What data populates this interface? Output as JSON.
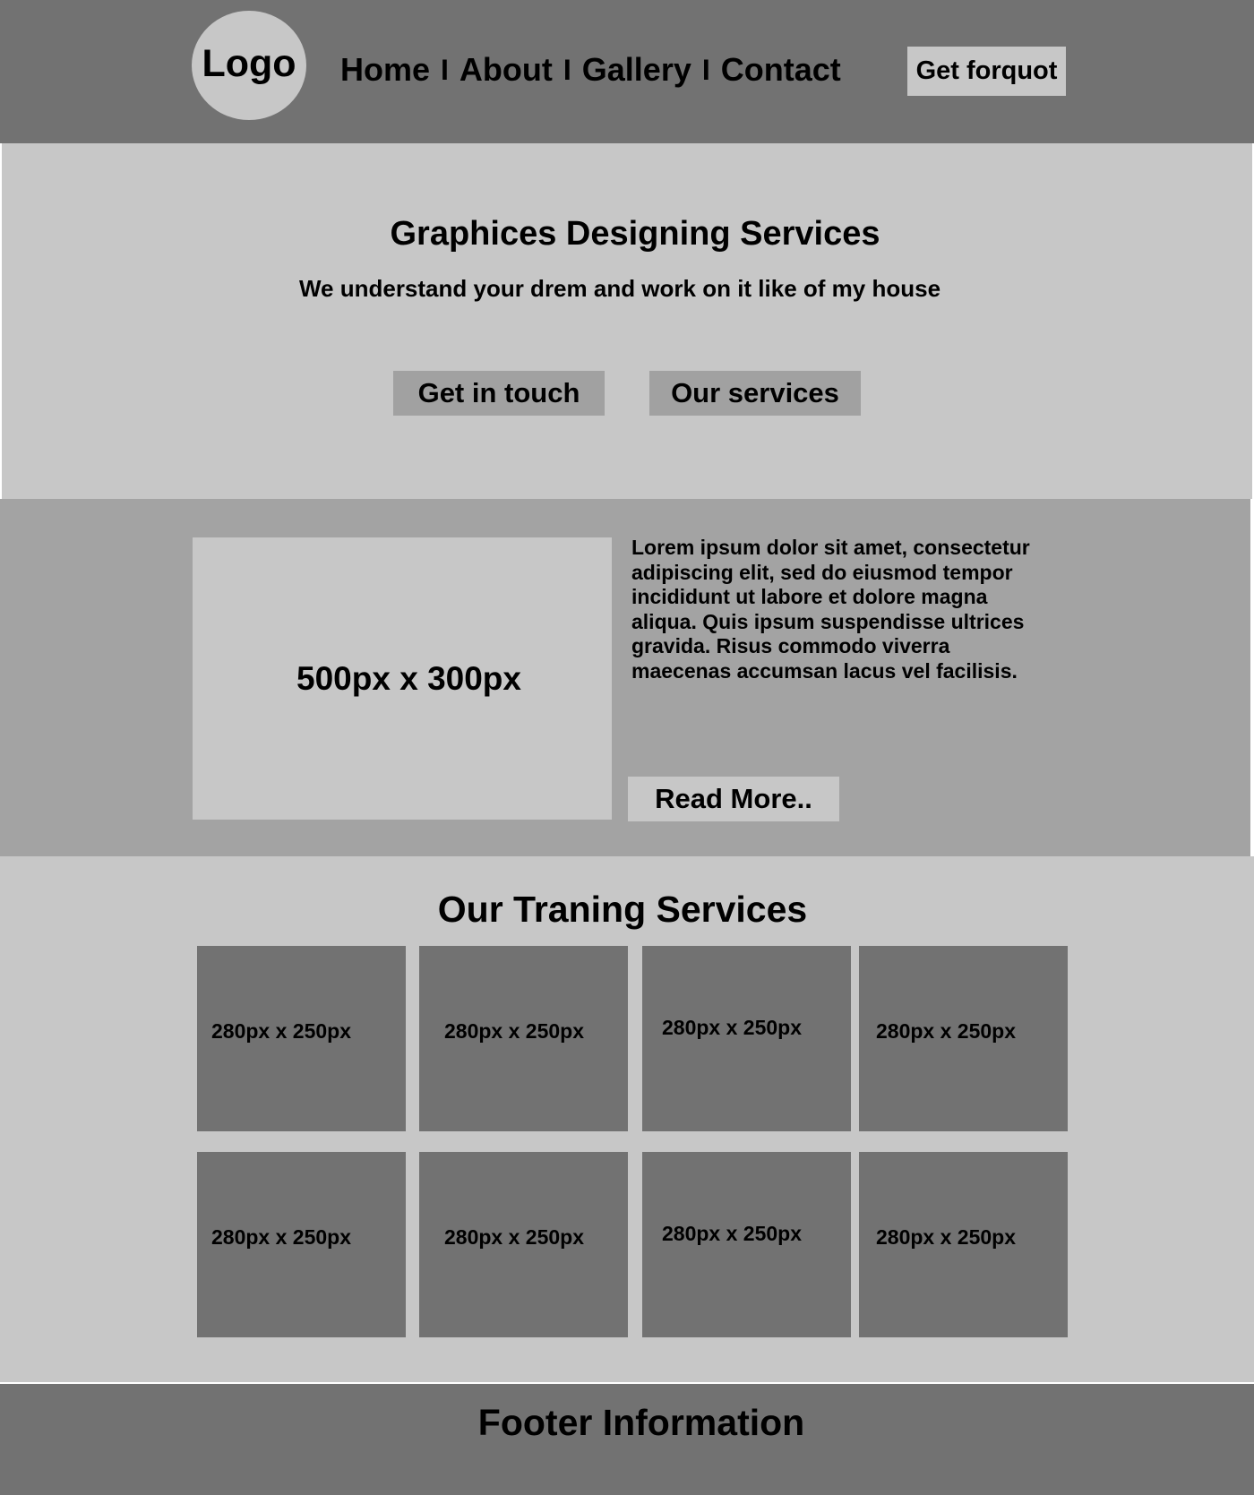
{
  "header": {
    "logo": "Logo",
    "nav": [
      {
        "label": "Home"
      },
      {
        "label": "About"
      },
      {
        "label": "Gallery"
      },
      {
        "label": "Contact"
      }
    ],
    "nav_separator": "I",
    "quote_button": "Get forquot"
  },
  "hero": {
    "title": "Graphices Designing Services",
    "subtitle": "We understand your drem and work on it like of my house",
    "buttons": [
      {
        "label": "Get in touch"
      },
      {
        "label": "Our services"
      }
    ]
  },
  "about": {
    "image_placeholder": "500px x 300px",
    "text": "Lorem ipsum dolor sit amet, consectetur adipiscing elit, sed do eiusmod tempor incididunt ut labore et dolore magna aliqua. Quis ipsum suspendisse ultrices gravida. Risus commodo viverra maecenas accumsan lacus vel facilisis.",
    "read_more": "Read More.."
  },
  "training": {
    "title": "Our Traning Services",
    "cards": [
      {
        "label": "280px x 250px"
      },
      {
        "label": "280px x 250px"
      },
      {
        "label": "280px x 250px"
      },
      {
        "label": "280px x 250px"
      },
      {
        "label": "280px x 250px"
      },
      {
        "label": "280px x 250px"
      },
      {
        "label": "280px x 250px"
      },
      {
        "label": "280px x 250px"
      }
    ]
  },
  "footer": {
    "text": "Footer Information"
  },
  "colors": {
    "dark_gray": "#727272",
    "light_gray": "#c7c7c7",
    "mid_gray": "#a3a3a3"
  }
}
